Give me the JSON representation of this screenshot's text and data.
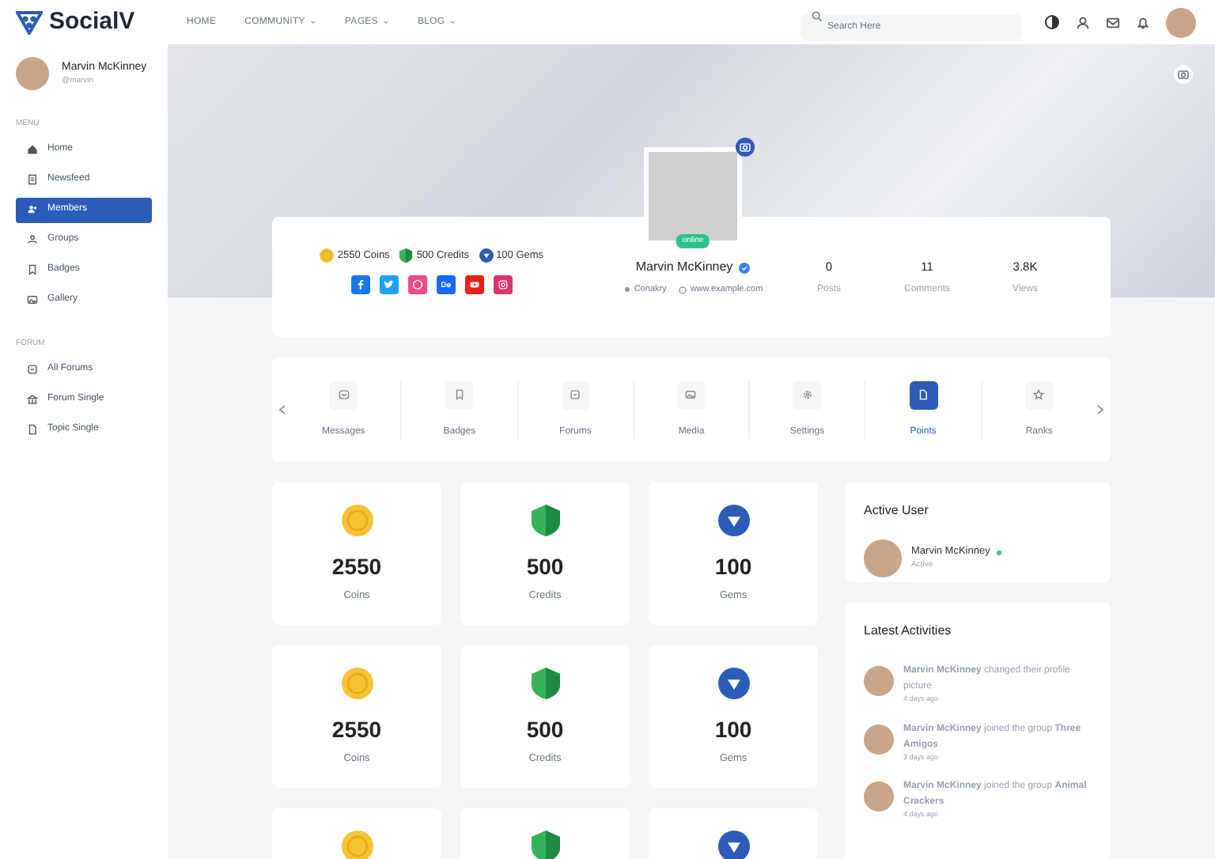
{
  "brand": {
    "name": "SocialV"
  },
  "nav": [
    {
      "label": "HOME",
      "dropdown": false
    },
    {
      "label": "COMMUNITY",
      "dropdown": true
    },
    {
      "label": "PAGES",
      "dropdown": true
    },
    {
      "label": "BLOG",
      "dropdown": true
    }
  ],
  "search": {
    "placeholder": "Search Here"
  },
  "sidebar": {
    "user": {
      "name": "Marvin McKinney",
      "handle": "@marvin"
    },
    "sections": [
      {
        "title": "MENU",
        "items": [
          {
            "label": "Home",
            "selected": false
          },
          {
            "label": "Newsfeed",
            "selected": false
          },
          {
            "label": "Members",
            "selected": true
          },
          {
            "label": "Groups",
            "selected": false
          },
          {
            "label": "Badges",
            "selected": false
          },
          {
            "label": "Gallery",
            "selected": false
          }
        ]
      },
      {
        "title": "FORUM",
        "items": [
          {
            "label": "All Forums",
            "selected": false
          },
          {
            "label": "Forum Single",
            "selected": false
          },
          {
            "label": "Topic Single",
            "selected": false
          }
        ]
      }
    ]
  },
  "profile": {
    "name": "Marvin McKinney",
    "verified": true,
    "status": "online",
    "location": "Conakry",
    "website": "www.example.com",
    "currencies": [
      {
        "kind": "coin",
        "label": "2550 Coins"
      },
      {
        "kind": "credit",
        "label": "500 Credits"
      },
      {
        "kind": "gem",
        "label": "100 Gems"
      }
    ],
    "socials": [
      {
        "kind": "facebook",
        "color": "#1877f2"
      },
      {
        "kind": "twitter",
        "color": "#1da1f2"
      },
      {
        "kind": "dribbble",
        "color": "#ea4c89"
      },
      {
        "kind": "behance",
        "color": "#1769ff"
      },
      {
        "kind": "youtube",
        "color": "#e62117"
      },
      {
        "kind": "instagram",
        "color": "#e1306c"
      }
    ],
    "stats": [
      {
        "value": "0",
        "label": "Posts"
      },
      {
        "value": "11",
        "label": "Comments"
      },
      {
        "value": "3.8K",
        "label": "Views"
      }
    ]
  },
  "tabs": [
    {
      "label": "Messages",
      "selected": false
    },
    {
      "label": "Badges",
      "selected": false
    },
    {
      "label": "Forums",
      "selected": false
    },
    {
      "label": "Media",
      "selected": false
    },
    {
      "label": "Settings",
      "selected": false
    },
    {
      "label": "Points",
      "selected": true
    },
    {
      "label": "Ranks",
      "selected": false
    }
  ],
  "point_cards": [
    {
      "kind": "coin",
      "value": "2550",
      "label": "Coins"
    },
    {
      "kind": "credit",
      "value": "500",
      "label": "Credits"
    },
    {
      "kind": "gem",
      "value": "100",
      "label": "Gems"
    },
    {
      "kind": "coin",
      "value": "2550",
      "label": "Coins"
    },
    {
      "kind": "credit",
      "value": "500",
      "label": "Credits"
    },
    {
      "kind": "gem",
      "value": "100",
      "label": "Gems"
    },
    {
      "kind": "coin"
    },
    {
      "kind": "credit"
    },
    {
      "kind": "gem"
    }
  ],
  "active_user": {
    "title": "Active User",
    "name": "Marvin McKinney",
    "online": true,
    "status": "Active"
  },
  "latest_activities": {
    "title": "Latest Activities",
    "items": [
      {
        "text": "**Marvin McKinney** changed their profile picture",
        "time": "4 days ago"
      },
      {
        "text": "**Marvin McKinney** joined the group **Three Amigos**",
        "time": "3 days ago"
      },
      {
        "text": "**Marvin McKinney** joined the group **Animal Crackers**",
        "time": "4 days ago"
      }
    ]
  }
}
